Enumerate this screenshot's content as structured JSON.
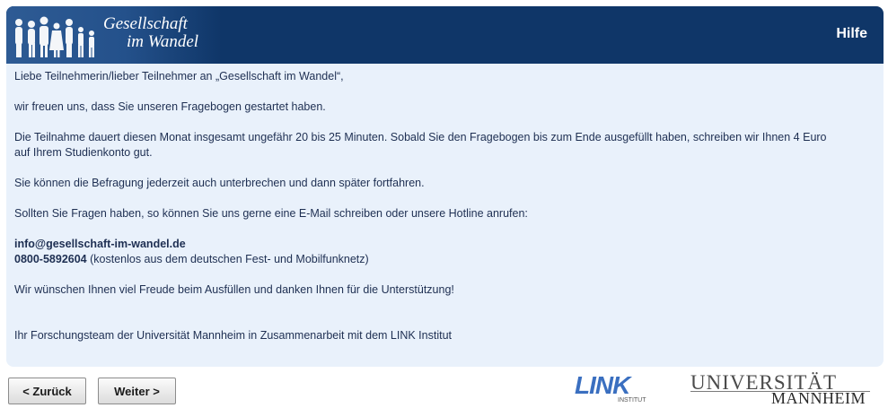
{
  "header": {
    "brand_line1": "Gesellschaft",
    "brand_line2": "im Wandel",
    "help_label": "Hilfe"
  },
  "content": {
    "greeting": "Liebe Teilnehmerin/lieber Teilnehmer an „Gesellschaft im Wandel“,",
    "intro": "wir freuen uns, dass Sie unseren Fragebogen gestartet haben.",
    "duration_line1": "Die Teilnahme dauert diesen Monat insgesamt ungefähr 20 bis 25 Minuten. Sobald Sie den Fragebogen bis zum Ende ausgefüllt haben, schreiben wir Ihnen 4 Euro",
    "duration_line2": "auf Ihrem Studienkonto gut.",
    "pause": "Sie können die Befragung jederzeit auch unterbrechen und dann später fortfahren.",
    "questions": "Sollten Sie Fragen haben, so können Sie uns gerne eine E-Mail schreiben oder unsere Hotline anrufen:",
    "email": "info@gesellschaft-im-wandel.de",
    "hotline": "0800-5892604",
    "hotline_note": " (kostenlos aus dem deutschen Fest- und Mobilfunknetz)",
    "wishes": "Wir wünschen Ihnen viel Freude beim Ausfüllen und danken Ihnen für die Unterstützung!",
    "signature": "Ihr Forschungsteam der Universität Mannheim in Zusammenarbeit mit dem LINK Institut"
  },
  "nav": {
    "back_label": "< Zurück",
    "next_label": "Weiter >"
  },
  "logos": {
    "link_name": "LINK",
    "link_sub": "INSTITUT",
    "uni_top": "UNIVERSITÄT",
    "uni_bottom": "MANNHEIM"
  },
  "colors": {
    "header_bg": "#0f3668",
    "panel_bg": "#e9f1fb",
    "link_blue": "#3a6fc0"
  }
}
